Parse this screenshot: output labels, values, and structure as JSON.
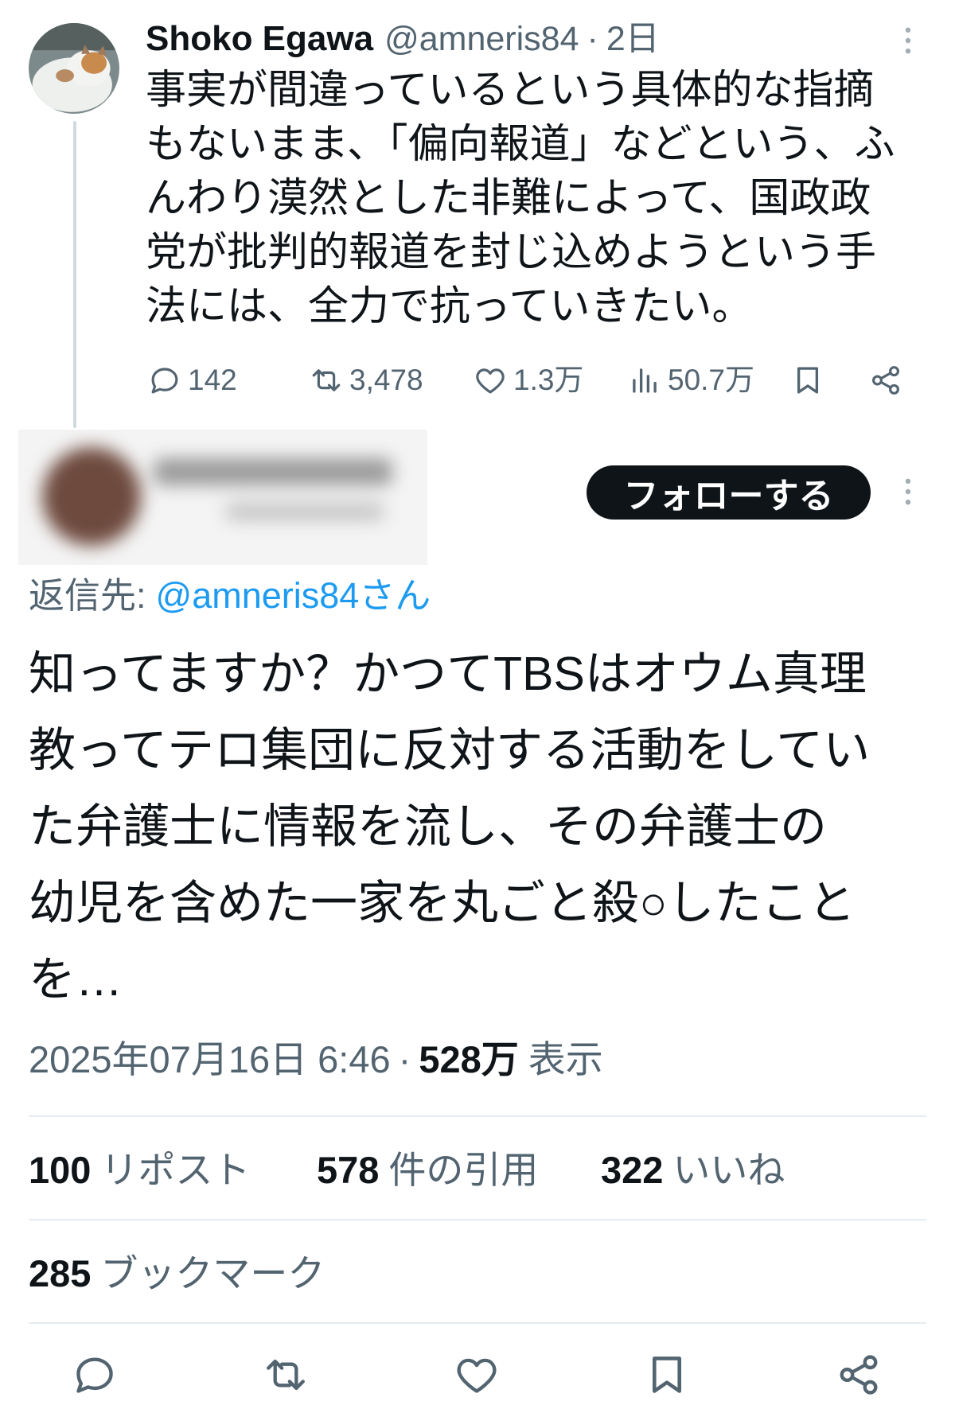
{
  "tweet": {
    "author_name": "Shoko Egawa",
    "handle": "@amneris84",
    "separator": "·",
    "time": "2日",
    "text_lines": [
      "事実が間違っているという具体的な指摘",
      "もないまま、「偏向報道」などという、ふ",
      "んわり漠然とした非難によって、国政政",
      "党が批判的報道を封じ込めようという手",
      "法には、全力で抗っていきたい。"
    ],
    "actions": {
      "replies": "142",
      "retweets": "3,478",
      "likes": "1.3万",
      "views": "50.7万"
    }
  },
  "reply": {
    "follow_label": "フォローする",
    "reply_to_prefix": "返信先:",
    "reply_to_handle": "@amneris84さん",
    "text_lines": [
      "知ってますか？かつてTBSはオウム真理",
      "教ってテロ集団に反対する活動をしてい",
      "た弁護士に情報を流し、その弁護士の",
      "幼児を含めた一家を丸ごと殺○したこと",
      "を…"
    ],
    "timestamp": "2025年07月16日 6:46",
    "separator": "·",
    "views_count": "528万",
    "views_label": "表示",
    "stats": {
      "reposts_count": "100",
      "reposts_label": "リポスト",
      "quotes_count": "578",
      "quotes_label": "件の引用",
      "likes_count": "322",
      "likes_label": "いいね",
      "bookmarks_count": "285",
      "bookmarks_label": "ブックマーク"
    }
  },
  "icons": {
    "tweet_actions": [
      "reply-icon",
      "retweet-icon",
      "like-icon",
      "views-icon",
      "bookmark-icon",
      "share-icon"
    ],
    "more": "more-vertical-icon",
    "bottom_actions": [
      "reply-icon",
      "retweet-icon",
      "like-icon",
      "bookmark-icon",
      "share-icon"
    ]
  },
  "colors": {
    "text_primary": "#0f1419",
    "text_secondary": "#536471",
    "link": "#1d9bf0",
    "follow_button_bg": "#0f1419",
    "follow_button_text": "#ffffff",
    "thread_line": "#cfd9de",
    "divider": "#e6ecf0"
  }
}
